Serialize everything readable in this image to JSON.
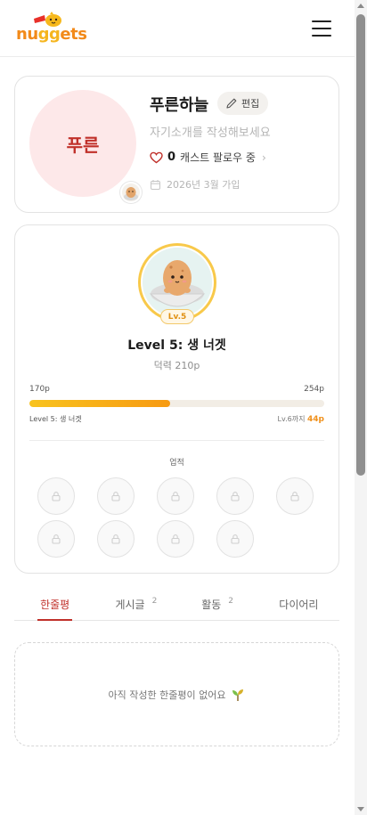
{
  "header": {
    "logo_text": "nuggets",
    "menu_icon": "hamburger-menu-icon"
  },
  "profile": {
    "avatar_text": "푸른",
    "nickname": "푸른하늘",
    "edit_label": "편집",
    "bio_placeholder": "자기소개를 작성해보세요",
    "follow_count": "0",
    "follow_label": "캐스트 팔로우 중",
    "joined": "2026년 3월 가입",
    "accent_color": "#c0302a",
    "avatar_bg": "#fde8e9"
  },
  "level": {
    "badge": "Lv.5",
    "title": "Level 5: 생 너겟",
    "power": "덕력 210p",
    "xp_min": "170p",
    "xp_max": "254p",
    "xp_progress": 0.476,
    "current_label": "Level 5: 생 너겟",
    "next_prefix": "Lv.6까지",
    "next_amount": "44p",
    "achievements_title": "업적",
    "achievement_slots": 9,
    "achievement_icon": "lock-icon"
  },
  "tabs": [
    {
      "label": "한줄평",
      "count": ""
    },
    {
      "label": "게시글",
      "count": "2"
    },
    {
      "label": "활동",
      "count": "2"
    },
    {
      "label": "다이어리",
      "count": ""
    }
  ],
  "empty_state": {
    "message": "아직 작성한 한줄평이 없어요",
    "icon": "sprout-icon"
  }
}
